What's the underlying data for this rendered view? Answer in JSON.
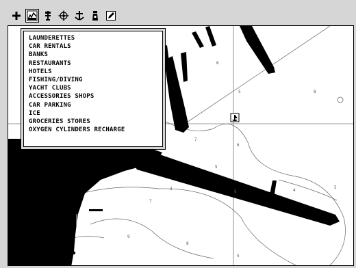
{
  "toolbar": {
    "tools": [
      {
        "icon": "plus-icon"
      },
      {
        "icon": "chart-icon"
      },
      {
        "icon": "flag-icon"
      },
      {
        "icon": "compass-icon"
      },
      {
        "icon": "anchor-icon"
      },
      {
        "icon": "lighthouse-icon"
      },
      {
        "icon": "pencil-icon"
      }
    ]
  },
  "menu": {
    "items": [
      "LAUNDERETTES",
      "CAR RENTALS",
      "BANKS",
      "RESTAURANTS",
      "HOTELS",
      "FISHING/DIVING",
      "YACHT CLUBS",
      "ACCESSORIES SHOPS",
      "CAR PARKING",
      "ICE",
      "GROCERIES STORES",
      "OXYGEN CYLINDERS RECHARGE"
    ]
  },
  "chart": {
    "soundings": [
      "6",
      "8",
      "5",
      "7",
      "6",
      "5",
      "3",
      "7",
      "8",
      "4",
      "5",
      "9",
      "8",
      "5"
    ],
    "colors": {
      "land": "#000000",
      "sea": "#ffffff",
      "ui": "#d6d6d6"
    }
  }
}
